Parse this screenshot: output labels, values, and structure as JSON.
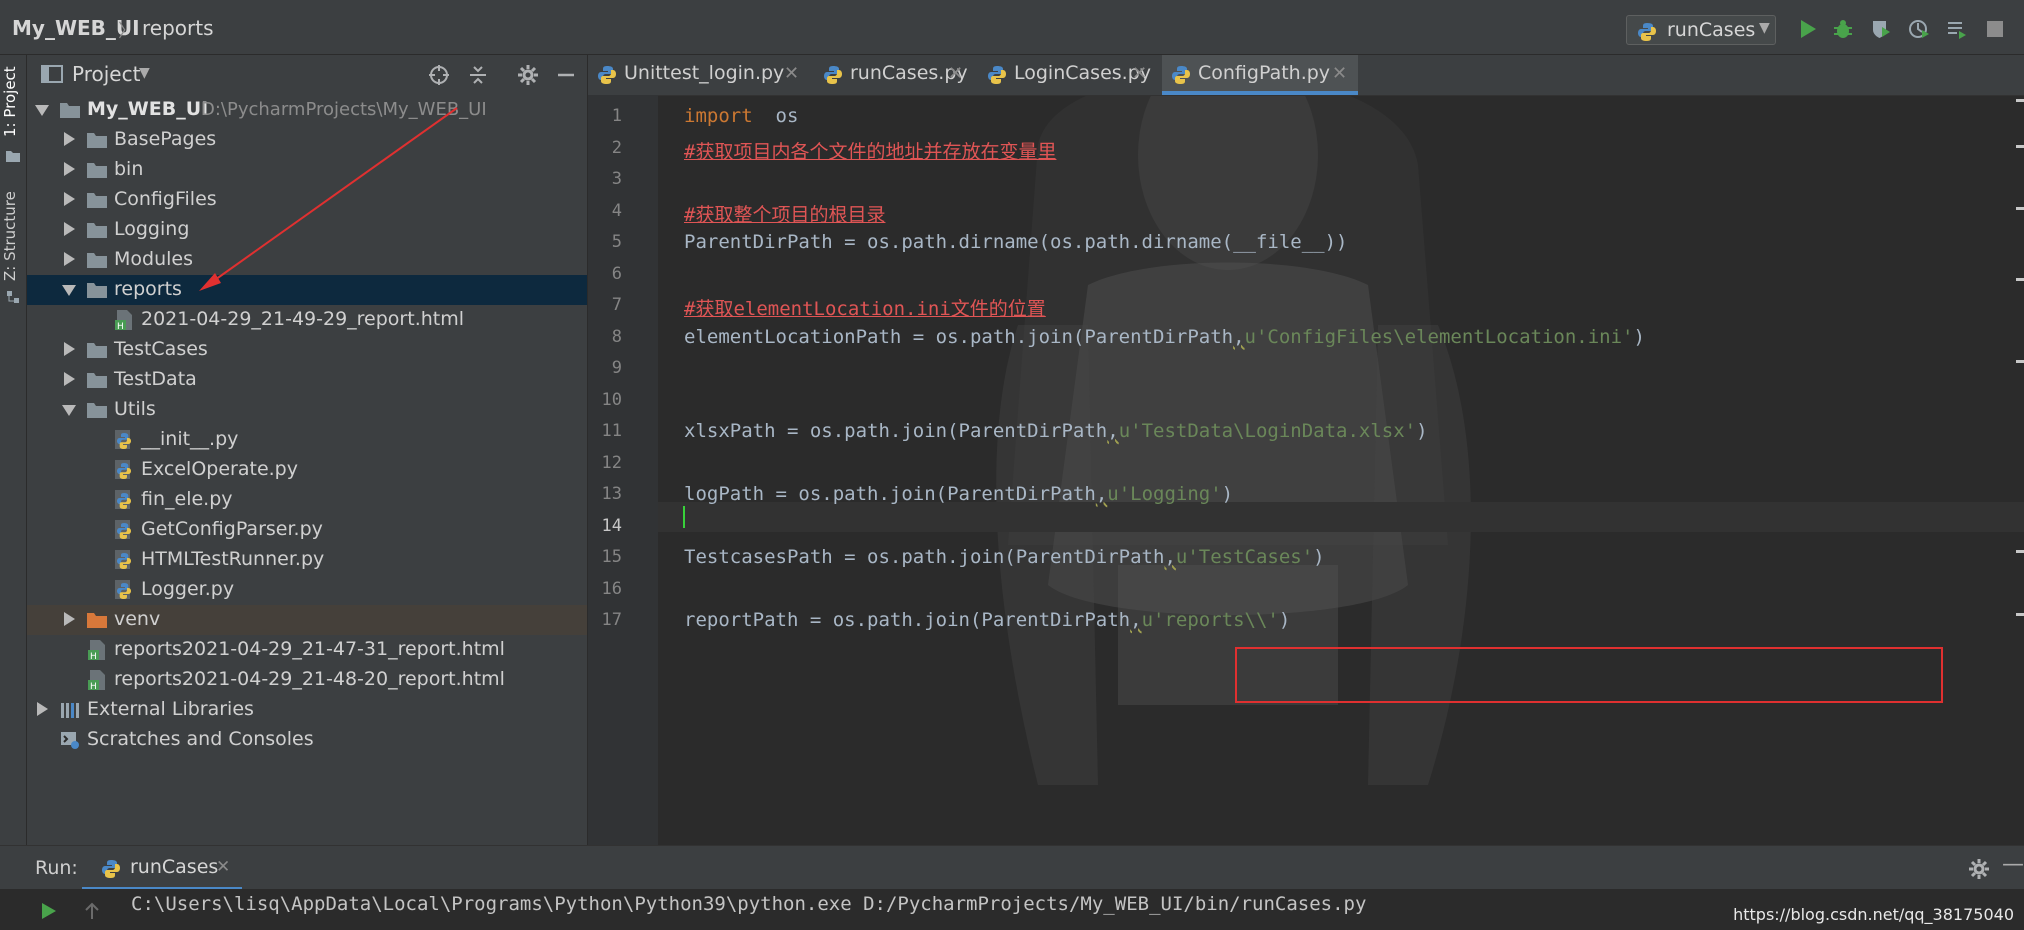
{
  "breadcrumb": {
    "project": "My_WEB_UI",
    "separator": "〉",
    "folder": "reports"
  },
  "toolbar": {
    "run_config": "runCases",
    "buttons": [
      {
        "name": "run-icon"
      },
      {
        "name": "debug-icon"
      },
      {
        "name": "coverage-icon"
      },
      {
        "name": "profile-icon"
      },
      {
        "name": "build-icon"
      },
      {
        "name": "stop-icon"
      }
    ]
  },
  "left_strip": {
    "project_tab": "1: Project",
    "structure_tab": "Z: Structure"
  },
  "project_panel": {
    "title": "Project",
    "tree": [
      {
        "label": "My_WEB_UI",
        "path": "D:\\PycharmProjects\\My_WEB_UI",
        "type": "folder",
        "expanded": true,
        "level": 0
      },
      {
        "label": "BasePages",
        "type": "folder",
        "expanded": false,
        "level": 1
      },
      {
        "label": "bin",
        "type": "folder",
        "expanded": false,
        "level": 1
      },
      {
        "label": "ConfigFiles",
        "type": "folder",
        "expanded": false,
        "level": 1
      },
      {
        "label": "Logging",
        "type": "folder",
        "expanded": false,
        "level": 1
      },
      {
        "label": "Modules",
        "type": "folder",
        "expanded": false,
        "level": 1
      },
      {
        "label": "reports",
        "type": "folder",
        "expanded": true,
        "level": 1,
        "selected": true
      },
      {
        "label": "2021-04-29_21-49-29_report.html",
        "type": "html",
        "level": 2
      },
      {
        "label": "TestCases",
        "type": "folder",
        "expanded": false,
        "level": 1
      },
      {
        "label": "TestData",
        "type": "folder",
        "expanded": false,
        "level": 1
      },
      {
        "label": "Utils",
        "type": "folder",
        "expanded": true,
        "level": 1
      },
      {
        "label": "__init__.py",
        "type": "py",
        "level": 2
      },
      {
        "label": "ExcelOperate.py",
        "type": "py",
        "level": 2
      },
      {
        "label": "fin_ele.py",
        "type": "py",
        "level": 2
      },
      {
        "label": "GetConfigParser.py",
        "type": "py",
        "level": 2
      },
      {
        "label": "HTMLTestRunner.py",
        "type": "py",
        "level": 2
      },
      {
        "label": "Logger.py",
        "type": "py",
        "level": 2
      },
      {
        "label": "venv",
        "type": "venv",
        "expanded": false,
        "level": 1
      },
      {
        "label": "reports2021-04-29_21-47-31_report.html",
        "type": "html",
        "level": 1
      },
      {
        "label": "reports2021-04-29_21-48-20_report.html",
        "type": "html",
        "level": 1
      },
      {
        "label": "External Libraries",
        "type": "lib",
        "expanded": false,
        "level": 0
      },
      {
        "label": "Scratches and Consoles",
        "type": "scratch",
        "level": 0
      }
    ]
  },
  "editor": {
    "tabs": [
      {
        "label": "Unittest_login.py",
        "active": false
      },
      {
        "label": "runCases.py",
        "active": false
      },
      {
        "label": "LoginCases.py",
        "active": false
      },
      {
        "label": "ConfigPath.py",
        "active": true
      }
    ],
    "current_line": 14,
    "lines": [
      {
        "n": "1",
        "parts": [
          {
            "t": "import",
            "c": "kw"
          },
          {
            "t": "  os",
            "c": ""
          }
        ]
      },
      {
        "n": "2",
        "parts": [
          {
            "t": "#获取项目内各个文件的地址并存放在变量里",
            "c": "cm"
          }
        ]
      },
      {
        "n": "3",
        "parts": []
      },
      {
        "n": "4",
        "parts": [
          {
            "t": "#获取整个项目的根目录",
            "c": "cm"
          }
        ]
      },
      {
        "n": "5",
        "parts": [
          {
            "t": "ParentDirPath = os.path.dirname(os.path.dirname(__file__))",
            "c": ""
          }
        ]
      },
      {
        "n": "6",
        "parts": []
      },
      {
        "n": "7",
        "parts": [
          {
            "t": "#获取elementLocation.ini文件的位置",
            "c": "cm"
          }
        ]
      },
      {
        "n": "8",
        "parts": [
          {
            "t": "elementLocationPath = os.path.join(ParentDirPath",
            "c": ""
          },
          {
            "t": ",",
            "c": "sq"
          },
          {
            "t": "u'ConfigFiles\\elementLocation.ini'",
            "c": "st"
          },
          {
            "t": ")",
            "c": ""
          }
        ]
      },
      {
        "n": "9",
        "parts": []
      },
      {
        "n": "10",
        "parts": []
      },
      {
        "n": "11",
        "parts": [
          {
            "t": "xlsxPath = os.path.join(ParentDirPath",
            "c": ""
          },
          {
            "t": ",",
            "c": "sq"
          },
          {
            "t": "u'TestData\\LoginData.xlsx'",
            "c": "st"
          },
          {
            "t": ")",
            "c": ""
          }
        ]
      },
      {
        "n": "12",
        "parts": []
      },
      {
        "n": "13",
        "parts": [
          {
            "t": "logPath = os.path.join(ParentDirPath",
            "c": ""
          },
          {
            "t": ",",
            "c": "sq"
          },
          {
            "t": "u'Logging'",
            "c": "st"
          },
          {
            "t": ")",
            "c": ""
          }
        ]
      },
      {
        "n": "14",
        "parts": []
      },
      {
        "n": "15",
        "parts": [
          {
            "t": "TestcasesPath = os.path.join(ParentDirPath",
            "c": ""
          },
          {
            "t": ",",
            "c": "sq"
          },
          {
            "t": "u'TestCases'",
            "c": "st"
          },
          {
            "t": ")",
            "c": ""
          }
        ]
      },
      {
        "n": "16",
        "parts": []
      },
      {
        "n": "17",
        "parts": [
          {
            "t": "reportPath = os.path.join(ParentDirPath",
            "c": ""
          },
          {
            "t": ",",
            "c": "sq"
          },
          {
            "t": "u'reports\\\\'",
            "c": "st"
          },
          {
            "t": ")",
            "c": ""
          }
        ]
      }
    ]
  },
  "run_panel": {
    "label": "Run:",
    "tab": "runCases",
    "command": "C:\\Users\\lisq\\AppData\\Local\\Programs\\Python\\Python39\\python.exe D:/PycharmProjects/My_WEB_UI/bin/runCases.py"
  },
  "watermark": "https://blog.csdn.net/qq_38175040",
  "colors": {
    "background": "#2b2b2b",
    "panel": "#3c3f41",
    "selection": "#0d293e",
    "keyword": "#cc7832",
    "comment": "#e05555",
    "string": "#6a8759",
    "accent": "#4a88c7",
    "annotation": "#e03030"
  }
}
